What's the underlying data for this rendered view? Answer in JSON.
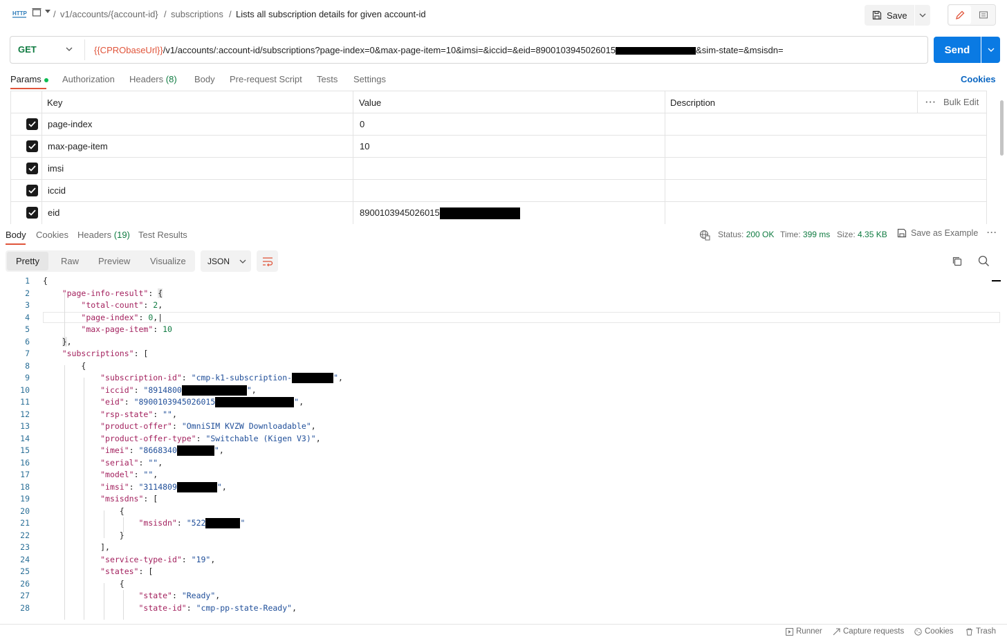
{
  "breadcrumb": {
    "collection": "v1/accounts/{account-id}",
    "folder": "subscriptions",
    "title": "Lists all subscription details for given account-id",
    "sep": "/"
  },
  "toolbar": {
    "save_label": "Save"
  },
  "request": {
    "method": "GET",
    "url_var": "{{CPRObaseUrl}}",
    "url_main": "/v1/accounts/:account-id/subscriptions?page-index=0&max-page-item=10&imsi=&iccid=&eid=8900103945026015",
    "url_tail": "&sim-state=&msisdn=",
    "send_label": "Send"
  },
  "request_tabs": {
    "params": "Params",
    "authorization": "Authorization",
    "headers": "Headers",
    "headers_count": "(8)",
    "body": "Body",
    "prerequest": "Pre-request Script",
    "tests": "Tests",
    "settings": "Settings",
    "cookies": "Cookies"
  },
  "params": {
    "headers": {
      "key": "Key",
      "value": "Value",
      "description": "Description",
      "bulk_edit": "Bulk Edit"
    },
    "rows": [
      {
        "key": "page-index",
        "value": "0"
      },
      {
        "key": "max-page-item",
        "value": "10"
      },
      {
        "key": "imsi",
        "value": ""
      },
      {
        "key": "iccid",
        "value": ""
      },
      {
        "key": "eid",
        "value": "8900103945026015"
      }
    ]
  },
  "response_tabs": {
    "body": "Body",
    "cookies": "Cookies",
    "headers": "Headers",
    "headers_count": "(19)",
    "tests": "Test Results"
  },
  "response_meta": {
    "status_label": "Status:",
    "status": "200 OK",
    "time_label": "Time:",
    "time": "399 ms",
    "size_label": "Size:",
    "size": "4.35 KB",
    "save_example": "Save as Example"
  },
  "view": {
    "pretty": "Pretty",
    "raw": "Raw",
    "preview": "Preview",
    "visualize": "Visualize",
    "format": "JSON"
  },
  "code_lines": [
    "1",
    "2",
    "3",
    "4",
    "5",
    "6",
    "7",
    "8",
    "9",
    "10",
    "11",
    "12",
    "13",
    "14",
    "15",
    "16",
    "17",
    "18",
    "19",
    "20",
    "21",
    "22",
    "23",
    "24",
    "25",
    "26",
    "27",
    "28"
  ],
  "code": {
    "page_info_result": "\"page-info-result\"",
    "total_count": "\"total-count\"",
    "total_count_val": "2",
    "page_index": "\"page-index\"",
    "page_index_val": "0",
    "max_page_item": "\"max-page-item\"",
    "max_page_item_val": "10",
    "subscriptions": "\"subscriptions\"",
    "subscription_id": "\"subscription-id\"",
    "subscription_id_val": "\"cmp-k1-subscription-",
    "iccid": "\"iccid\"",
    "iccid_val": "\"8914800",
    "eid": "\"eid\"",
    "eid_val": "\"8900103945026015",
    "rsp_state": "\"rsp-state\"",
    "rsp_state_val": "\"\"",
    "product_offer": "\"product-offer\"",
    "product_offer_val": "\"OmniSIM KVZW Downloadable\"",
    "product_offer_type": "\"product-offer-type\"",
    "product_offer_type_val": "\"Switchable (Kigen V3)\"",
    "imei": "\"imei\"",
    "imei_val": "\"8668340",
    "serial": "\"serial\"",
    "serial_val": "\"\"",
    "model": "\"model\"",
    "model_val": "\"\"",
    "imsi": "\"imsi\"",
    "imsi_val": "\"3114809",
    "msisdns": "\"msisdns\"",
    "msisdn": "\"msisdn\"",
    "msisdn_val": "\"522",
    "service_type_id": "\"service-type-id\"",
    "service_type_id_val": "\"19\"",
    "states": "\"states\"",
    "state": "\"state\"",
    "state_val": "\"Ready\"",
    "state_id": "\"state-id\"",
    "state_id_val": "\"cmp-pp-state-Ready\""
  },
  "statusbar": {
    "runner": "Runner",
    "capture": "Capture requests",
    "cookies": "Cookies",
    "trash": "Trash"
  }
}
